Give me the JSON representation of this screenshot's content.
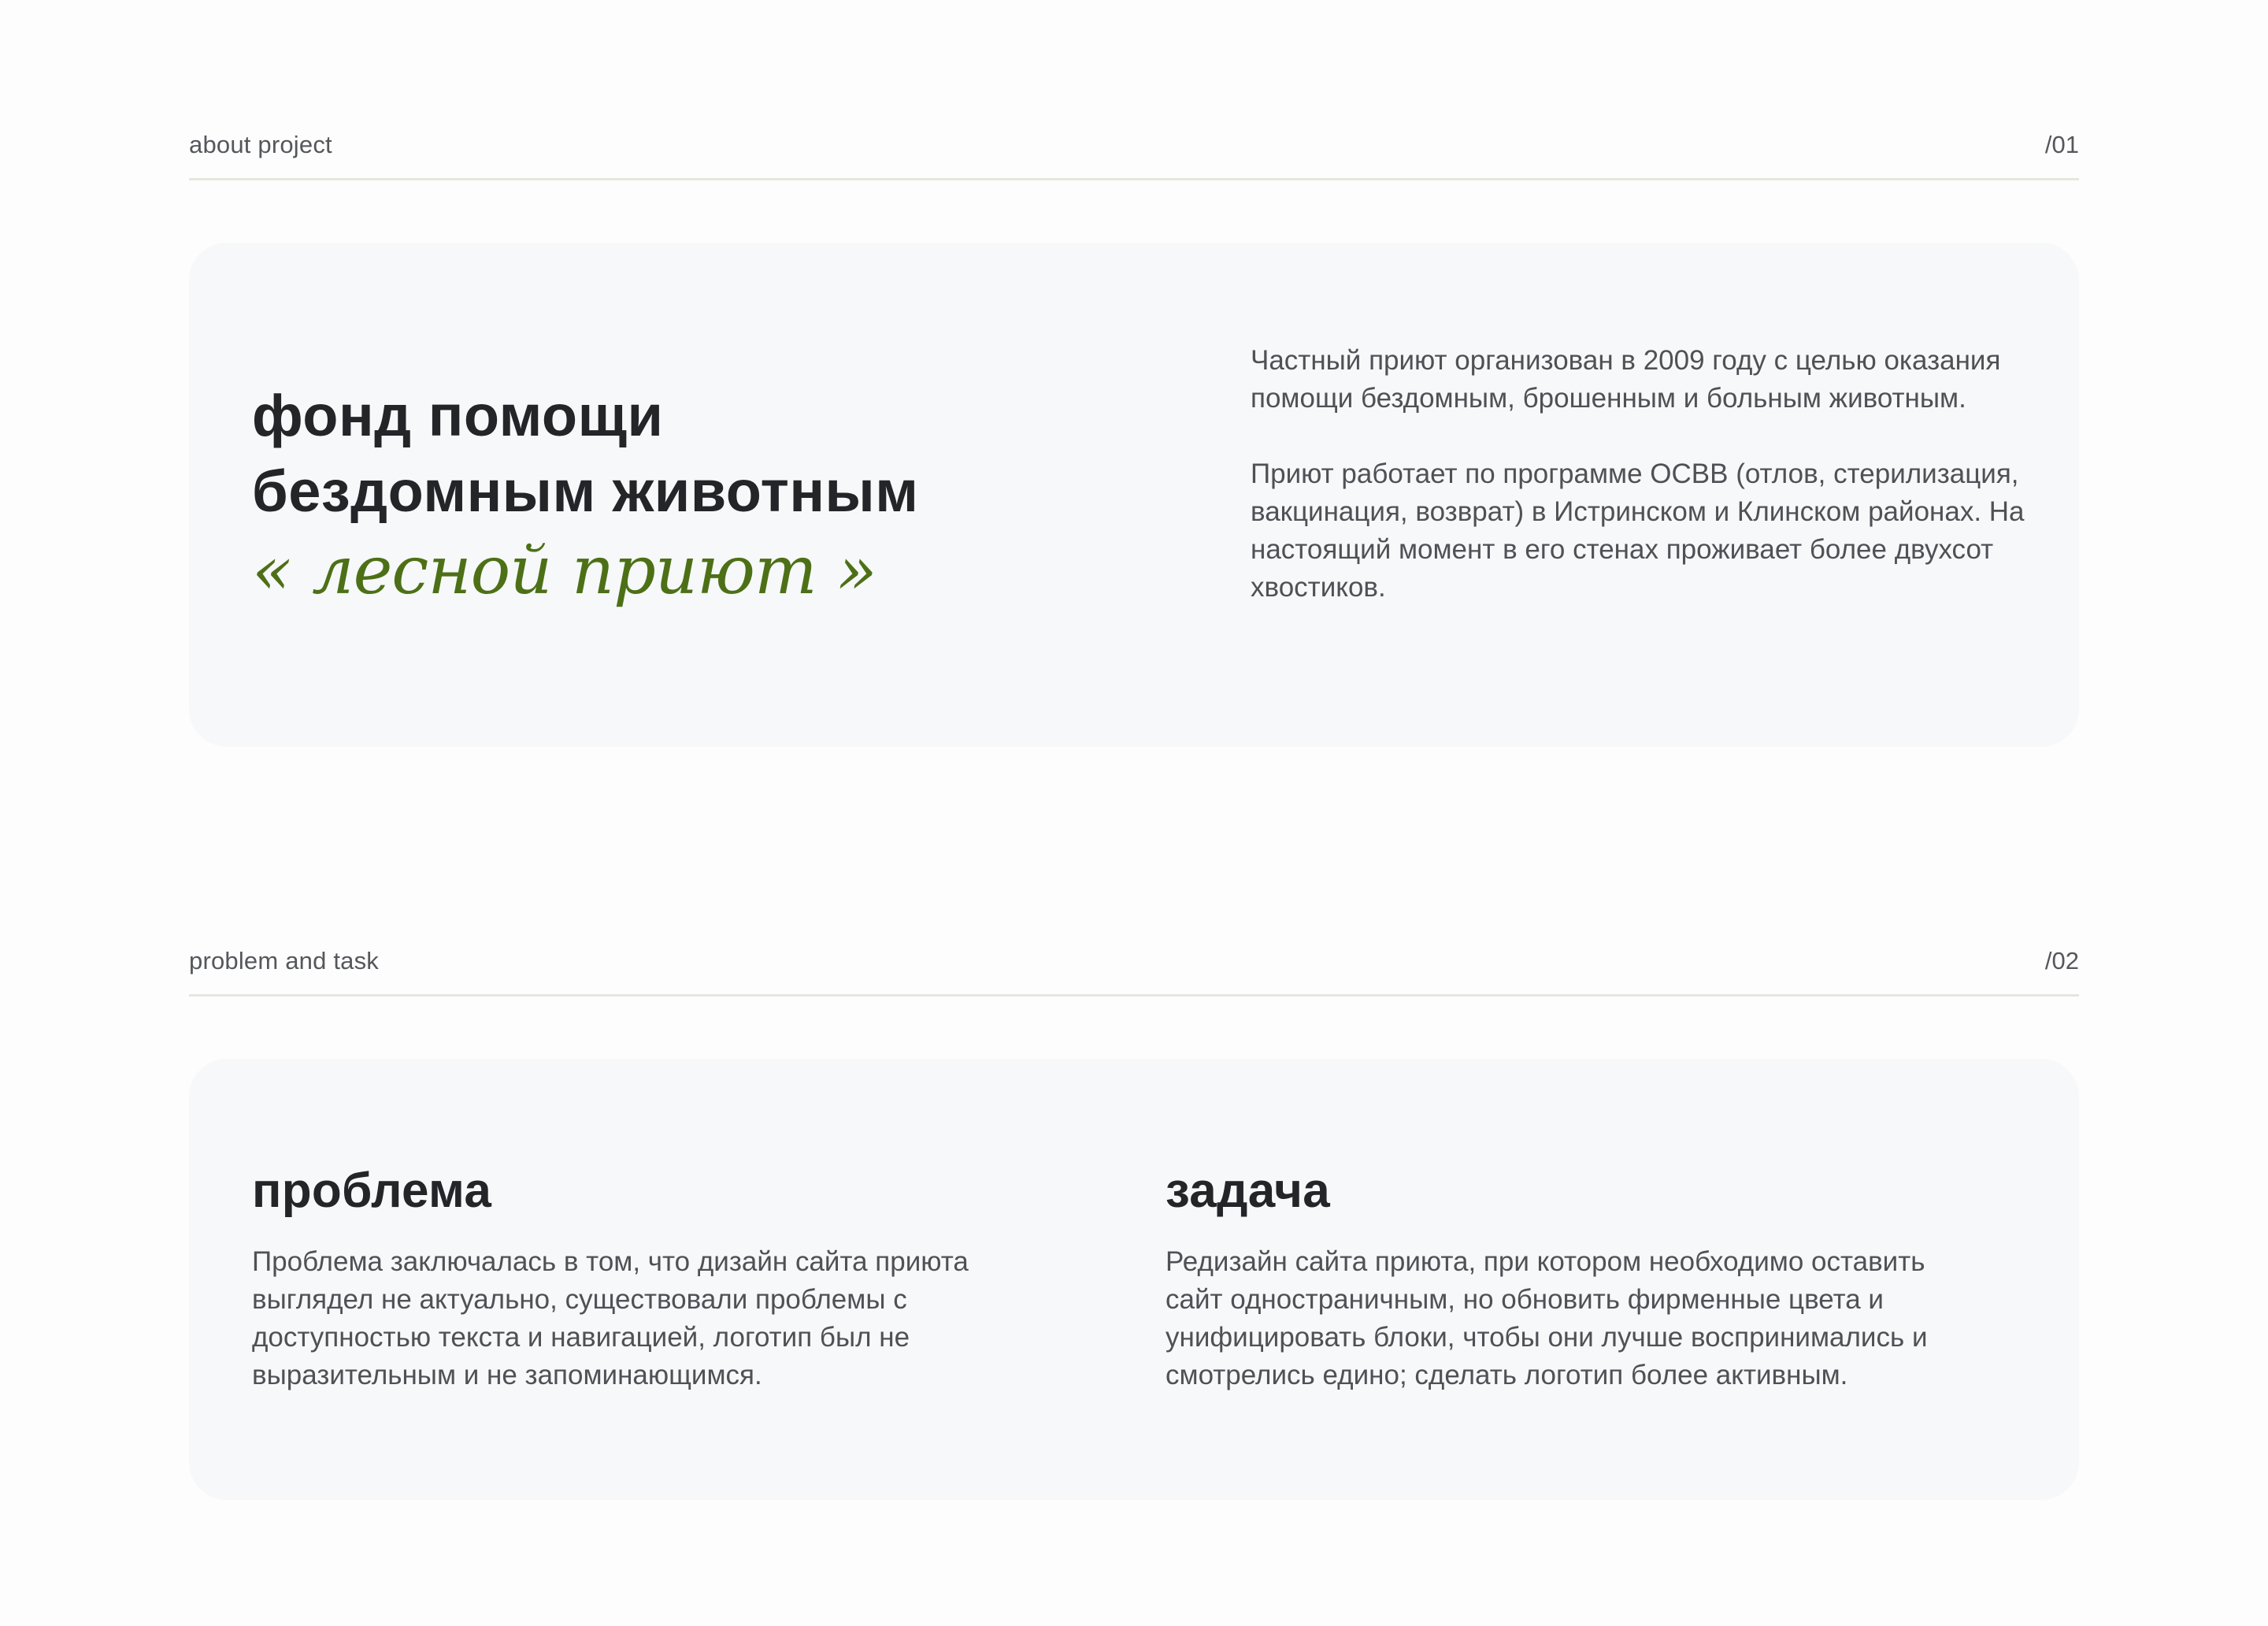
{
  "sections": {
    "about": {
      "label": "about project",
      "number": "/01",
      "headline_line1": "фонд помощи",
      "headline_line2": "бездомным животным",
      "headline_script": "« лесной приют »",
      "paragraph1": "Частный приют организован в 2009 году с целью оказания помощи бездомным, брошенным и больным животным.",
      "paragraph2": "Приют работает по программе ОСВВ (отлов, стерилизация, вакцинация, возврат) в Истринском и Клинском районах. На настоящий момент в его стенах проживает более двухсот хвостиков."
    },
    "problem_task": {
      "label": "problem and task",
      "number": "/02",
      "problem_title": "проблема",
      "problem_text": "Проблема заключалась в том, что дизайн сайта приюта выглядел не актуально, существовали проблемы с доступностью текста и навигацией, логотип был не выразительным и не запоминающимся.",
      "task_title": "задача",
      "task_text": "Редизайн сайта приюта, при котором необходимо оставить сайт одностраничным, но обновить фирменные цвета и унифицировать блоки, чтобы они лучше воспринимались и смотрелись едино; сделать логотип более активным."
    }
  },
  "colors": {
    "accent_green": "#4d7017",
    "card_bg": "#f7f8f9",
    "divider": "#e7e6dc"
  }
}
